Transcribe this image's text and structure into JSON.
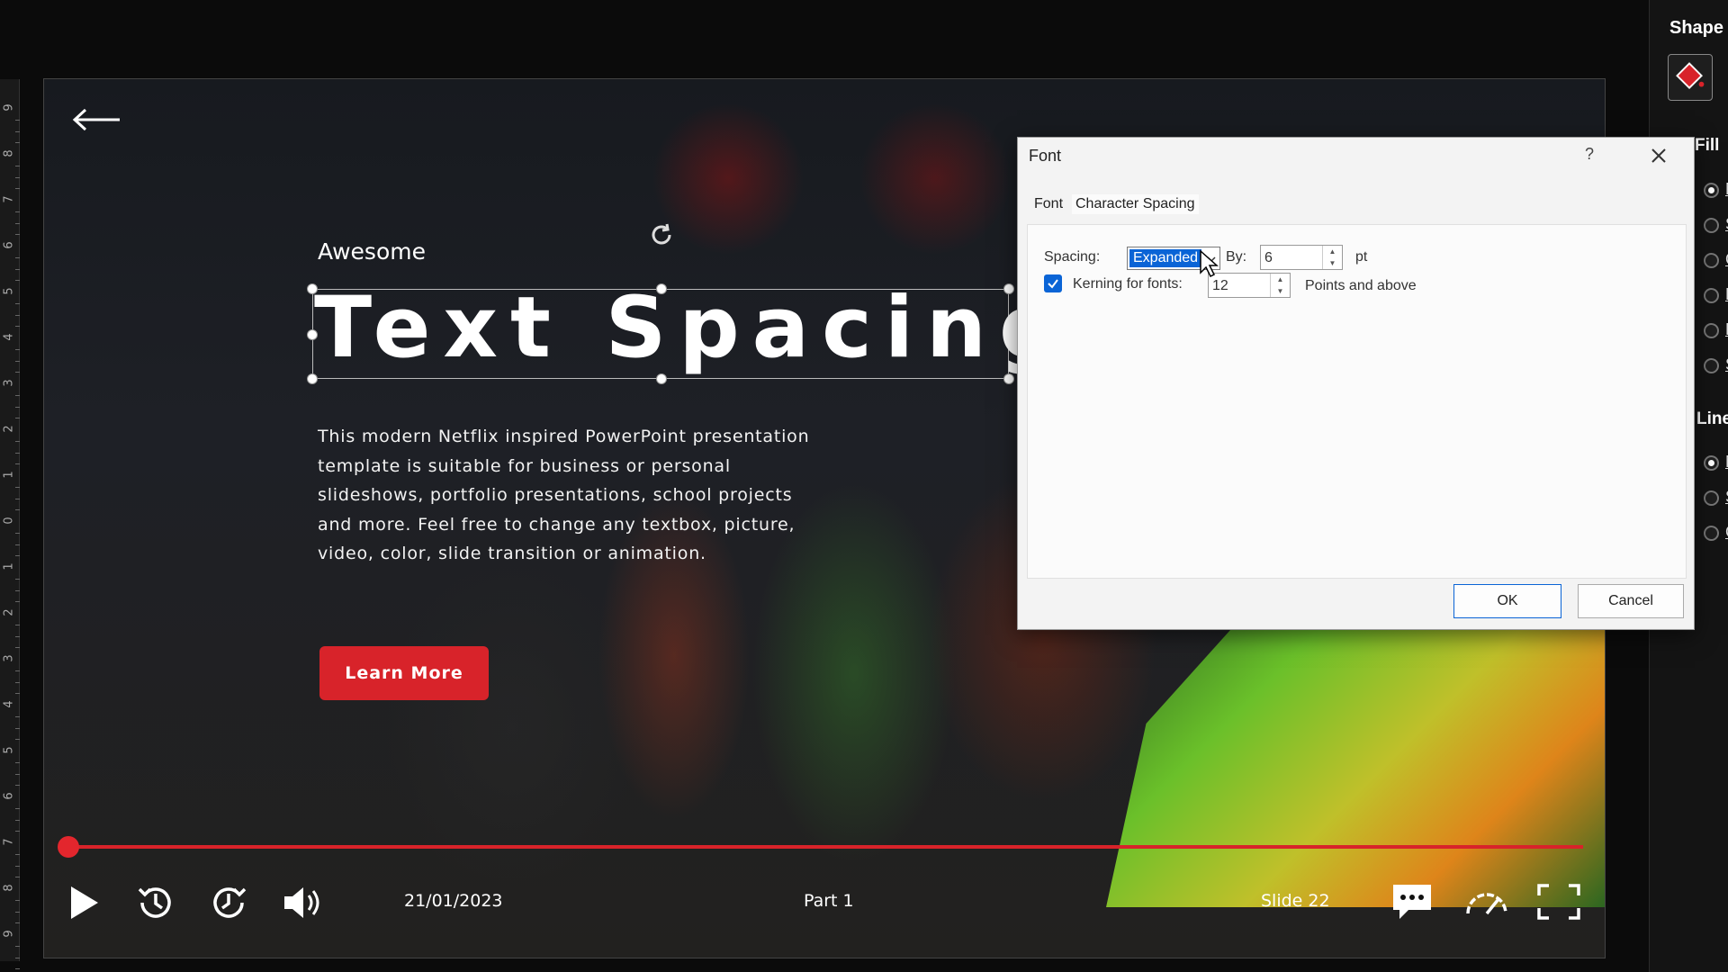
{
  "ruler": {
    "labels": [
      "9",
      "8",
      "7",
      "6",
      "5",
      "4",
      "3",
      "2",
      "1",
      "0",
      "1",
      "2",
      "3",
      "4",
      "5",
      "6",
      "7",
      "8",
      "9"
    ]
  },
  "slide": {
    "subtitle": "Awesome",
    "title": "Text Spacing",
    "body": "This modern Netflix inspired PowerPoint presentation template is suitable for business or personal slideshows, portfolio presentations, school projects and more. Feel free to change any textbox, picture, video, color, slide transition or animation.",
    "cta_label": "Learn More",
    "accent_color": "#d8232a",
    "controls": {
      "date": "21/01/2023",
      "part": "Part 1",
      "slide_label": "Slide 22",
      "progress_fraction": 0.0
    }
  },
  "side_panel": {
    "title": "Shape (",
    "fill_heading": "Fill",
    "line_heading": "Line",
    "fill_options": [
      "N",
      "S",
      "G",
      "P",
      "P",
      "S"
    ],
    "line_options": [
      "N",
      "S",
      "G"
    ]
  },
  "font_dialog": {
    "title": "Font",
    "help": "?",
    "tabs": [
      "Font",
      "Character Spacing"
    ],
    "active_tab": "Character Spacing",
    "spacing_label": "Spacing:",
    "spacing_value": "Expanded",
    "by_label": "By:",
    "by_value": "6",
    "by_unit": "pt",
    "kerning_label": "Kerning for fonts:",
    "kerning_checked": true,
    "kerning_value": "12",
    "kerning_suffix": "Points and above",
    "ok_label": "OK",
    "cancel_label": "Cancel",
    "selection_color": "#0a64d6"
  }
}
